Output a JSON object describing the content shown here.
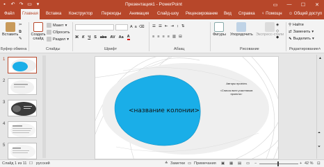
{
  "window": {
    "title": "Презентация1 - PowerPoint",
    "accent": "#b7472a"
  },
  "tabs": [
    "Файл",
    "Главная",
    "Вставка",
    "Конструктор",
    "Переходы",
    "Анимация",
    "Слайд-шоу",
    "Рецензирование",
    "Вид",
    "Справка",
    "Помощн",
    "Общий доступ"
  ],
  "active_tab": "Главная",
  "ribbon": {
    "clipboard": {
      "paste": "Вставить",
      "label": "Буфер обмена"
    },
    "slides": {
      "new_slide": "Создать слайд",
      "layout": "Макет",
      "reset": "Сбросить",
      "section": "Раздел",
      "label": "Слайды"
    },
    "font": {
      "label": "Шрифт"
    },
    "paragraph": {
      "label": "Абзац"
    },
    "drawing": {
      "shapes": "Фигуры",
      "arrange": "Упорядочить",
      "quick_styles": "Экспресс-стили",
      "label": "Рисование"
    },
    "editing": {
      "find": "Найти",
      "replace": "Заменить",
      "select": "Выделить",
      "label": "Редактирование"
    }
  },
  "slide": {
    "title": "<название колонии>",
    "authors_heading": "Авторы проекта",
    "authors_list": "<Список всех участников проекта>",
    "shape_color": "#1aaee8"
  },
  "thumbnails": [
    "1",
    "2",
    "3",
    "4",
    "5"
  ],
  "status": {
    "slide_count": "Слайд 1 из 11",
    "language": "русский",
    "notes": "Заметки",
    "comments": "Примечания",
    "zoom": "42 %"
  }
}
